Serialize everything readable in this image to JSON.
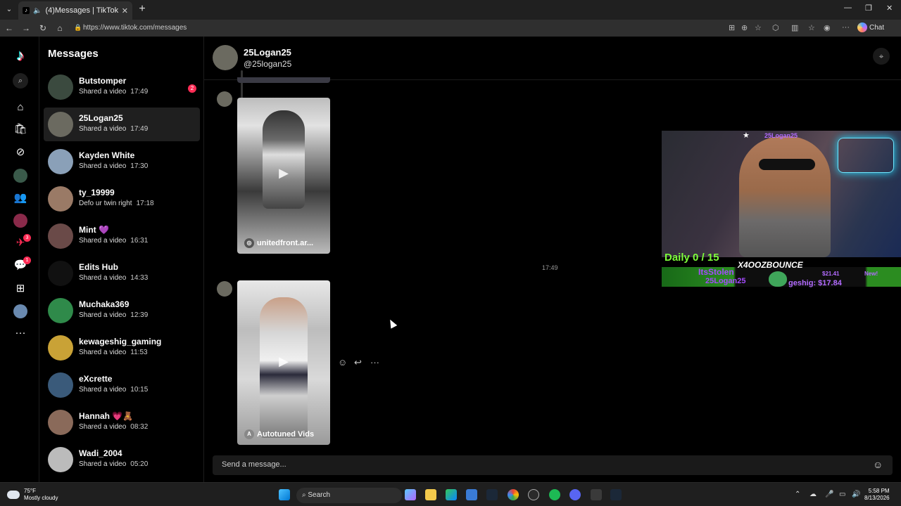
{
  "browser": {
    "tab_title": "(4)Messages | TikTok",
    "url": "https://www.tiktok.com/messages",
    "chat_label": "Chat"
  },
  "rail": {
    "notif_badges": [
      "3",
      "1"
    ]
  },
  "sidebar": {
    "title": "Messages",
    "conversations": [
      {
        "name": "Butstomper",
        "preview": "Shared a video",
        "time": "17:49",
        "badge": "2",
        "avatar_color": "#3b4a3f"
      },
      {
        "name": "25Logan25",
        "preview": "Shared a video",
        "time": "17:49",
        "badge": "",
        "avatar_color": "#6b6a60"
      },
      {
        "name": "Kayden White",
        "preview": "Shared a video",
        "time": "17:30",
        "badge": "",
        "avatar_color": "#8aa0b8"
      },
      {
        "name": "ty_19999",
        "preview": "Defo ur twin right",
        "time": "17:18",
        "badge": "",
        "avatar_color": "#9a7a66"
      },
      {
        "name": "Mint 💜",
        "preview": "Shared a video",
        "time": "16:31",
        "badge": "",
        "avatar_color": "#6a4a48"
      },
      {
        "name": "Edits Hub",
        "preview": "Shared a video",
        "time": "14:33",
        "badge": "",
        "avatar_color": "#111111"
      },
      {
        "name": "Muchaka369",
        "preview": "Shared a video",
        "time": "12:39",
        "badge": "",
        "avatar_color": "#2f8a4a"
      },
      {
        "name": "kewageshig_gaming",
        "preview": "Shared a video",
        "time": "11:53",
        "badge": "",
        "avatar_color": "#c9a236"
      },
      {
        "name": "eXcrette",
        "preview": "Shared a video",
        "time": "10:15",
        "badge": "",
        "avatar_color": "#3a5a7a"
      },
      {
        "name": "Hannah 💗🧸",
        "preview": "Shared a video",
        "time": "08:32",
        "badge": "",
        "avatar_color": "#8a6a5a"
      },
      {
        "name": "Wadi_2004",
        "preview": "Shared a video",
        "time": "05:20",
        "badge": "",
        "avatar_color": "#bbbbbb"
      }
    ]
  },
  "chat": {
    "name": "25Logan25",
    "handle": "@25logan25",
    "timestamp": "17:49",
    "videos": [
      {
        "caption": "unitedfront.ar...",
        "colors": [
          "#cfcfcf",
          "#3a3a3a"
        ]
      },
      {
        "caption": "Autotuned Vids",
        "colors": [
          "#d8d8d8",
          "#4a4a4a"
        ]
      }
    ],
    "composer_placeholder": "Send a message..."
  },
  "stream_overlay": {
    "header": "25Logan25",
    "daily": "Daily 0 / 15",
    "channel": "X4OOZBOUNCE",
    "stolen": "ItsStolen",
    "amount_top": "$21.41",
    "new_label": "New!",
    "user": "25Logan25",
    "amount_bottom": "geshig: $17.84"
  },
  "taskbar": {
    "weather_temp": "75°F",
    "weather_desc": "Mostly cloudy",
    "search_label": "Search",
    "time": "5:58 PM",
    "date": "8/13/2026"
  }
}
